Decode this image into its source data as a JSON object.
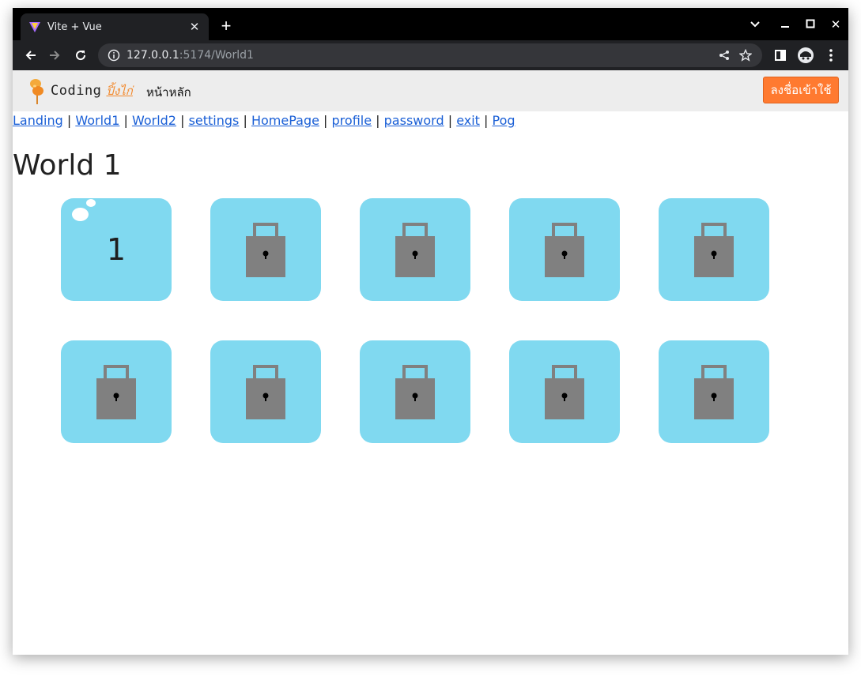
{
  "browser": {
    "tab_title": "Vite + Vue",
    "url_host": "127.0.0.1",
    "url_path": ":5174/World1"
  },
  "navbar": {
    "logo_text": "Coding",
    "logo_thai": "ปิ้งไก่",
    "home_label": "หน้าหลัก",
    "signup_label": "ลงชื่อเข้าใช้"
  },
  "links": [
    "Landing",
    "World1",
    "World2",
    "settings",
    "HomePage",
    "profile",
    "password",
    "exit",
    "Pog"
  ],
  "world": {
    "title": "World 1",
    "levels": [
      {
        "label": "1",
        "locked": false
      },
      {
        "label": "",
        "locked": true
      },
      {
        "label": "",
        "locked": true
      },
      {
        "label": "",
        "locked": true
      },
      {
        "label": "",
        "locked": true
      },
      {
        "label": "",
        "locked": true
      },
      {
        "label": "",
        "locked": true
      },
      {
        "label": "",
        "locked": true
      },
      {
        "label": "",
        "locked": true
      },
      {
        "label": "",
        "locked": true
      }
    ]
  },
  "colors": {
    "level_bg": "#80d9f0",
    "lock": "#808080",
    "signup_btn": "#ff7a30",
    "link": "#1a5fd6"
  },
  "icons": {
    "locked_level": "padlock-icon",
    "unlocked_level": "bubble-decoration"
  }
}
